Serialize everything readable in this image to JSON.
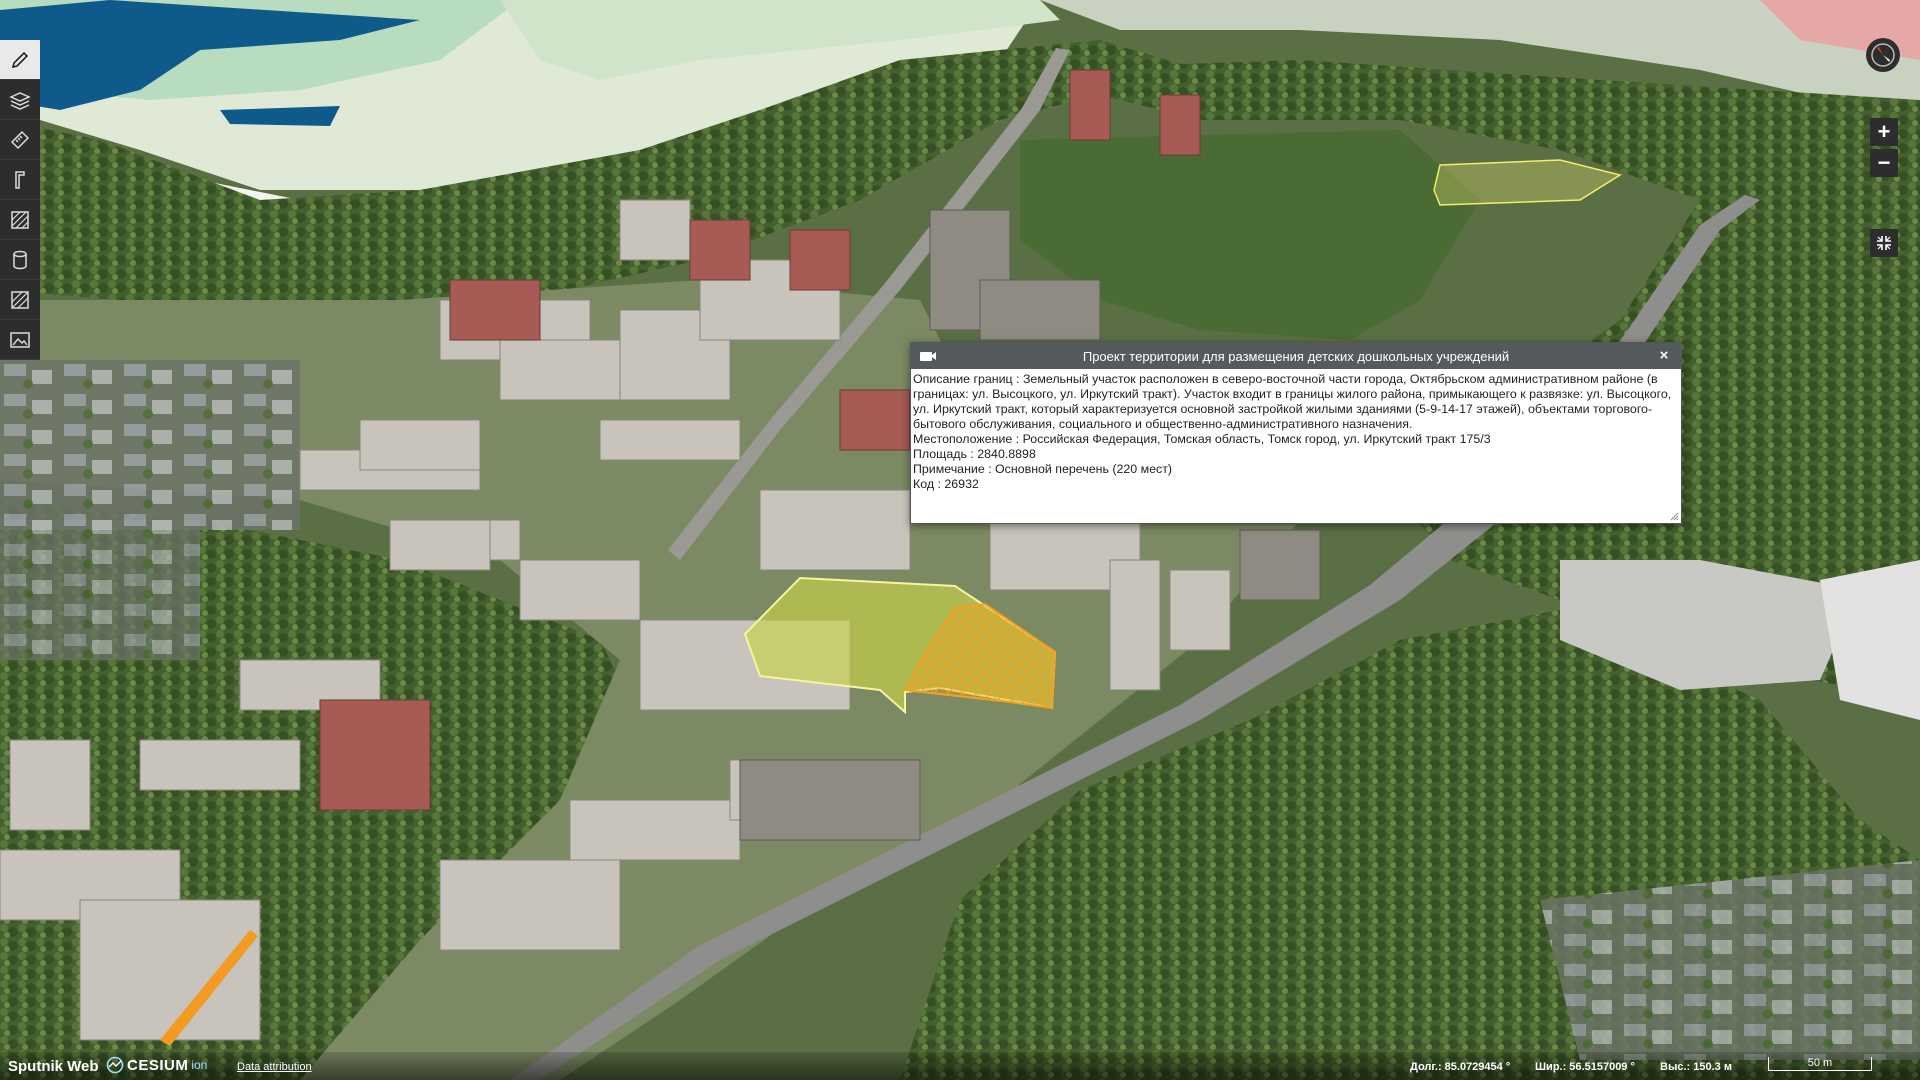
{
  "popup": {
    "title": "Проект территории для размещения детских дошкольных учреждений",
    "close_label": "×",
    "lines": [
      "Описание границ : Земельный участок расположен в северо-восточной части города, Октябрьском административном районе (в границах: ул. Высоцкого, ул. Иркутский тракт). Участок входит в границы жилого района, примыкающего к развязке: ул. Высоцкого, ул. Иркутский тракт, который характеризуется основной застройкой жилыми зданиями (5-9-14-17 этажей), объектами торгового-бытового обслуживания, социального и общественно-административного назначения.",
      "Местоположение : Российская Федерация, Томская область, Томск город, ул. Иркутский тракт 175/3",
      "Площадь : 2840.8898",
      "Примечание : Основной перечень (220 мест)",
      "Код : 26932"
    ]
  },
  "toolbar": {
    "tools": [
      {
        "name": "pencil-icon"
      },
      {
        "name": "layers-icon"
      },
      {
        "name": "ruler-icon"
      },
      {
        "name": "vertical-measure-icon"
      },
      {
        "name": "area-hatch-icon"
      },
      {
        "name": "cylinder-icon"
      },
      {
        "name": "slope-icon"
      },
      {
        "name": "image-icon"
      }
    ]
  },
  "controls": {
    "zoom_in": "+",
    "zoom_out": "−"
  },
  "bottom": {
    "brand": "Sputnik Web",
    "cesium": "CESIUM",
    "cesium_ion": "ion",
    "attribution": "Data attribution",
    "lon": "Долг.: 85.0729454 °",
    "lat": "Шир.: 56.5157009 °",
    "alt": "Выс.: 150.3 м",
    "scale": "50 m"
  },
  "colors": {
    "toolbar_bg": "#2d2d2d",
    "popup_header": "#555b5c",
    "parcel_fill": "#c9d34a",
    "parcel_hatch": "#f0a020",
    "forest": "#3f5a2c"
  }
}
